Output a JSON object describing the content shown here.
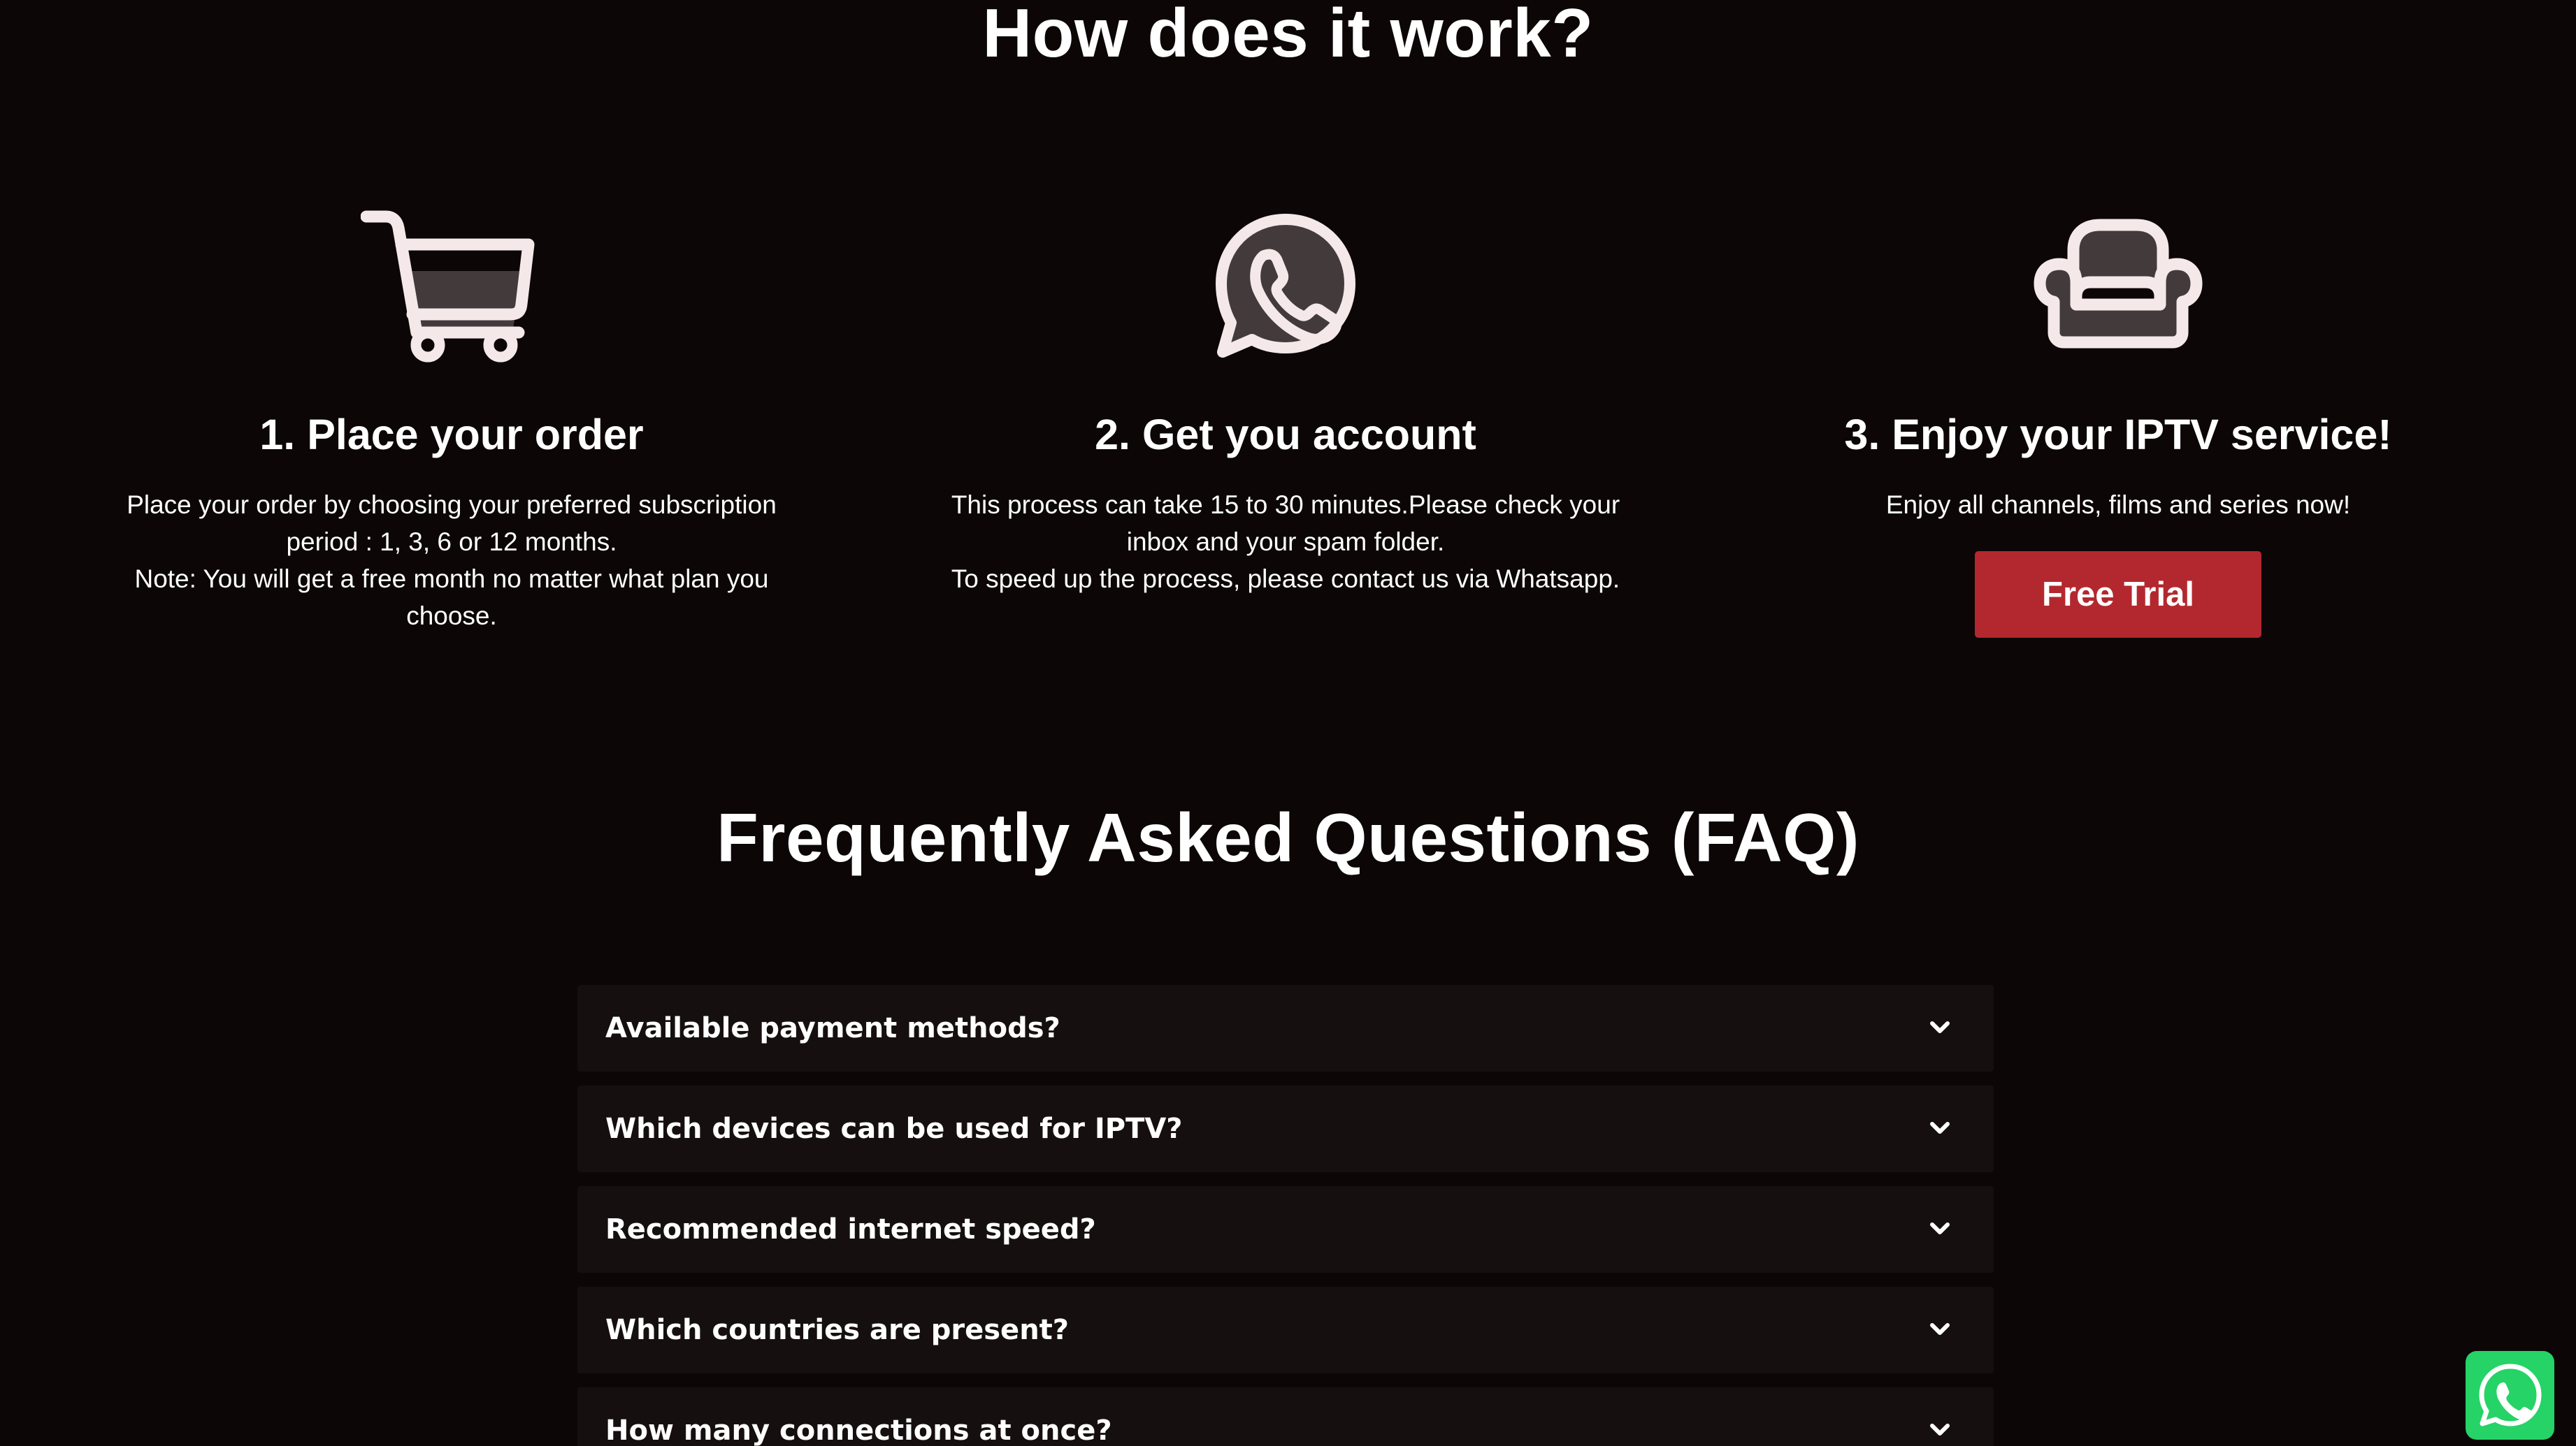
{
  "how": {
    "title": "How does it work?"
  },
  "steps": [
    {
      "icon": "shopping-cart-icon",
      "title": "1. Place your order",
      "lines": [
        "Place your order by choosing your preferred subscription period : 1, 3, 6 or 12 months.",
        "Note: You will get a free month no matter what plan you choose."
      ]
    },
    {
      "icon": "whatsapp-icon",
      "title": "2. Get you account",
      "lines": [
        "This process can take 15 to 30 minutes.Please check your inbox and your spam folder.",
        "To speed up the process, please contact us via Whatsapp."
      ]
    },
    {
      "icon": "armchair-icon",
      "title": "3. Enjoy your IPTV service!",
      "lines": [
        "Enjoy all channels, films and series now!"
      ],
      "button_label": "Free Trial"
    }
  ],
  "faq": {
    "title": "Frequently Asked Questions (FAQ)",
    "items": [
      {
        "question": "Available payment methods?"
      },
      {
        "question": "Which devices can be used for IPTV?"
      },
      {
        "question": "Recommended internet speed?"
      },
      {
        "question": "Which countries are present?"
      },
      {
        "question": "How many connections at once?"
      }
    ]
  },
  "colors": {
    "background": "#0c0607",
    "button": "#b3282e",
    "faq_item": "#160f10",
    "icon_fill": "#433a3b",
    "icon_stroke": "#f4e8e8",
    "whatsapp": "#25d366"
  },
  "floating": {
    "icon": "whatsapp-chat-icon"
  }
}
